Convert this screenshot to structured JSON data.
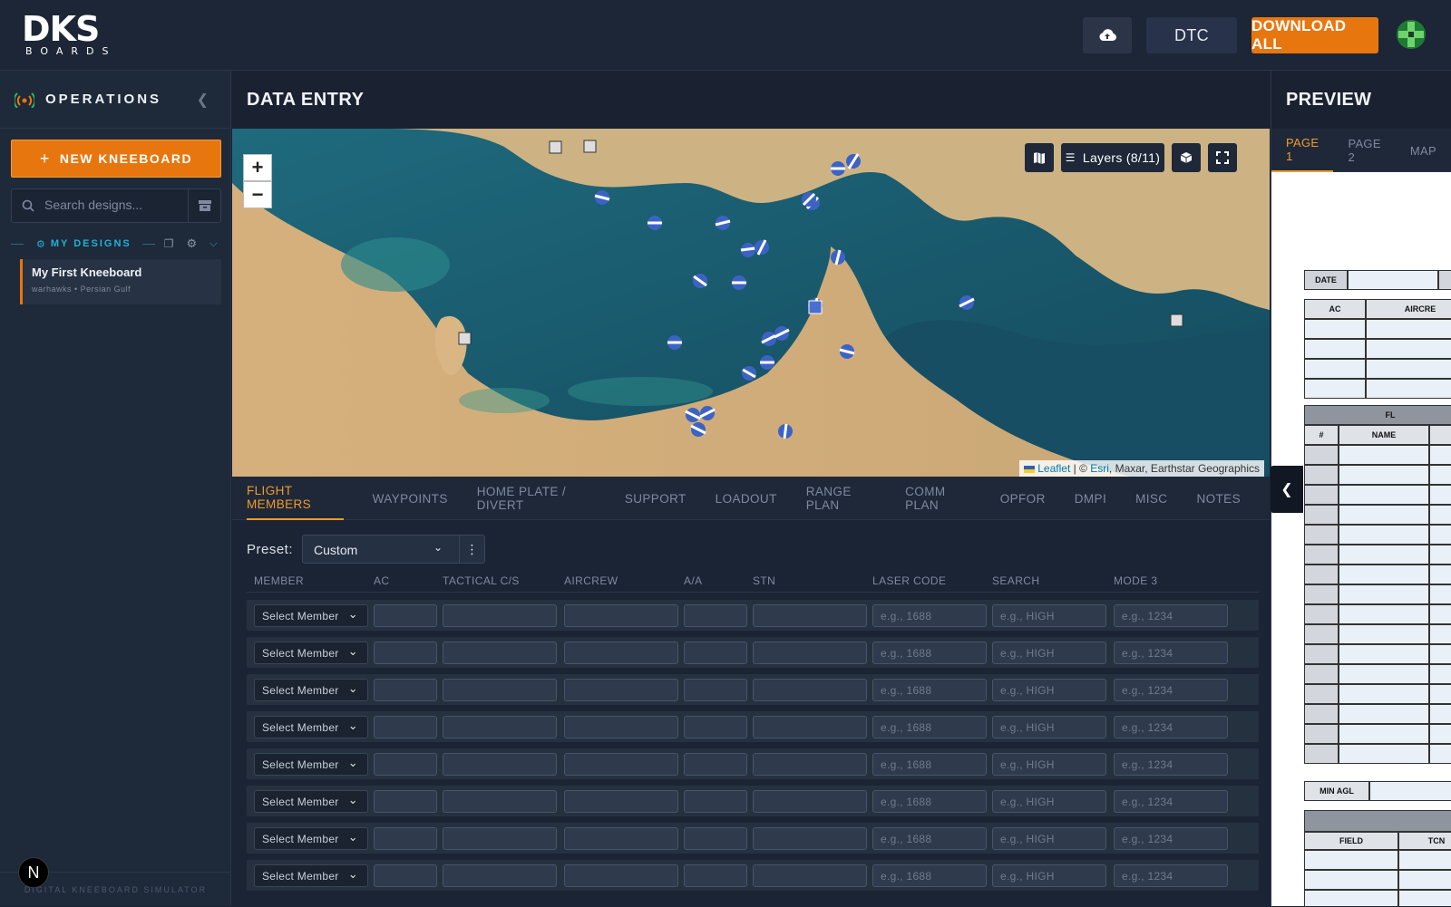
{
  "header": {
    "logo_big": "DKS",
    "logo_small": "BOARDS",
    "dtc_label": "DTC",
    "download_label": "DOWNLOAD ALL"
  },
  "sidebar": {
    "title": "OPERATIONS",
    "new_kneeboard_label": "NEW KNEEBOARD",
    "search_placeholder": "Search designs...",
    "designs_label": "MY DESIGNS",
    "designs": [
      {
        "title": "My First Kneeboard",
        "subtitle": "warhawks • Persian Gulf"
      }
    ],
    "footer": "DIGITAL KNEEBOARD SIMULATOR"
  },
  "n_badge": "N",
  "main": {
    "title": "DATA ENTRY",
    "map": {
      "zoom_in": "+",
      "zoom_out": "−",
      "layers_label": "Layers (8/11)",
      "attribution_leaflet": "Leaflet",
      "attribution_sep": " | © ",
      "attribution_esri": "Esri",
      "attribution_rest": ", Maxar, Earthstar Geographics"
    },
    "tabs": [
      "FLIGHT MEMBERS",
      "WAYPOINTS",
      "HOME PLATE / DIVERT",
      "SUPPORT",
      "LOADOUT",
      "RANGE PLAN",
      "COMM PLAN",
      "OPFOR",
      "DMPI",
      "MISC",
      "NOTES"
    ],
    "active_tab": "FLIGHT MEMBERS",
    "preset": {
      "label": "Preset:",
      "value": "Custom"
    },
    "columns": [
      "MEMBER",
      "AC",
      "TACTICAL C/S",
      "AIRCREW",
      "A/A",
      "STN",
      "LASER CODE",
      "SEARCH",
      "MODE 3"
    ],
    "row_select_label": "Select Member",
    "placeholders": {
      "laser": "e.g., 1688",
      "search": "e.g., HIGH",
      "mode3": "e.g., 1234"
    },
    "row_count": 8
  },
  "preview": {
    "title": "PREVIEW",
    "tabs": [
      "PAGE 1",
      "PAGE 2",
      "MAP"
    ],
    "active_tab": "PAGE 1",
    "sheet": {
      "date_label": "DATE",
      "ac_label": "AC",
      "aircrew_label": "AIRCRE",
      "flight_label": "FL",
      "num_label": "#",
      "name_label": "NAME",
      "min_agl_label": "MIN AGL",
      "field_label": "FIELD",
      "tcn_label": "TCN"
    }
  },
  "colors": {
    "accent": "#e8760f",
    "active_tab": "#f29a28",
    "bg": "#1b2434",
    "designs_cyan": "#1fb2d6"
  }
}
